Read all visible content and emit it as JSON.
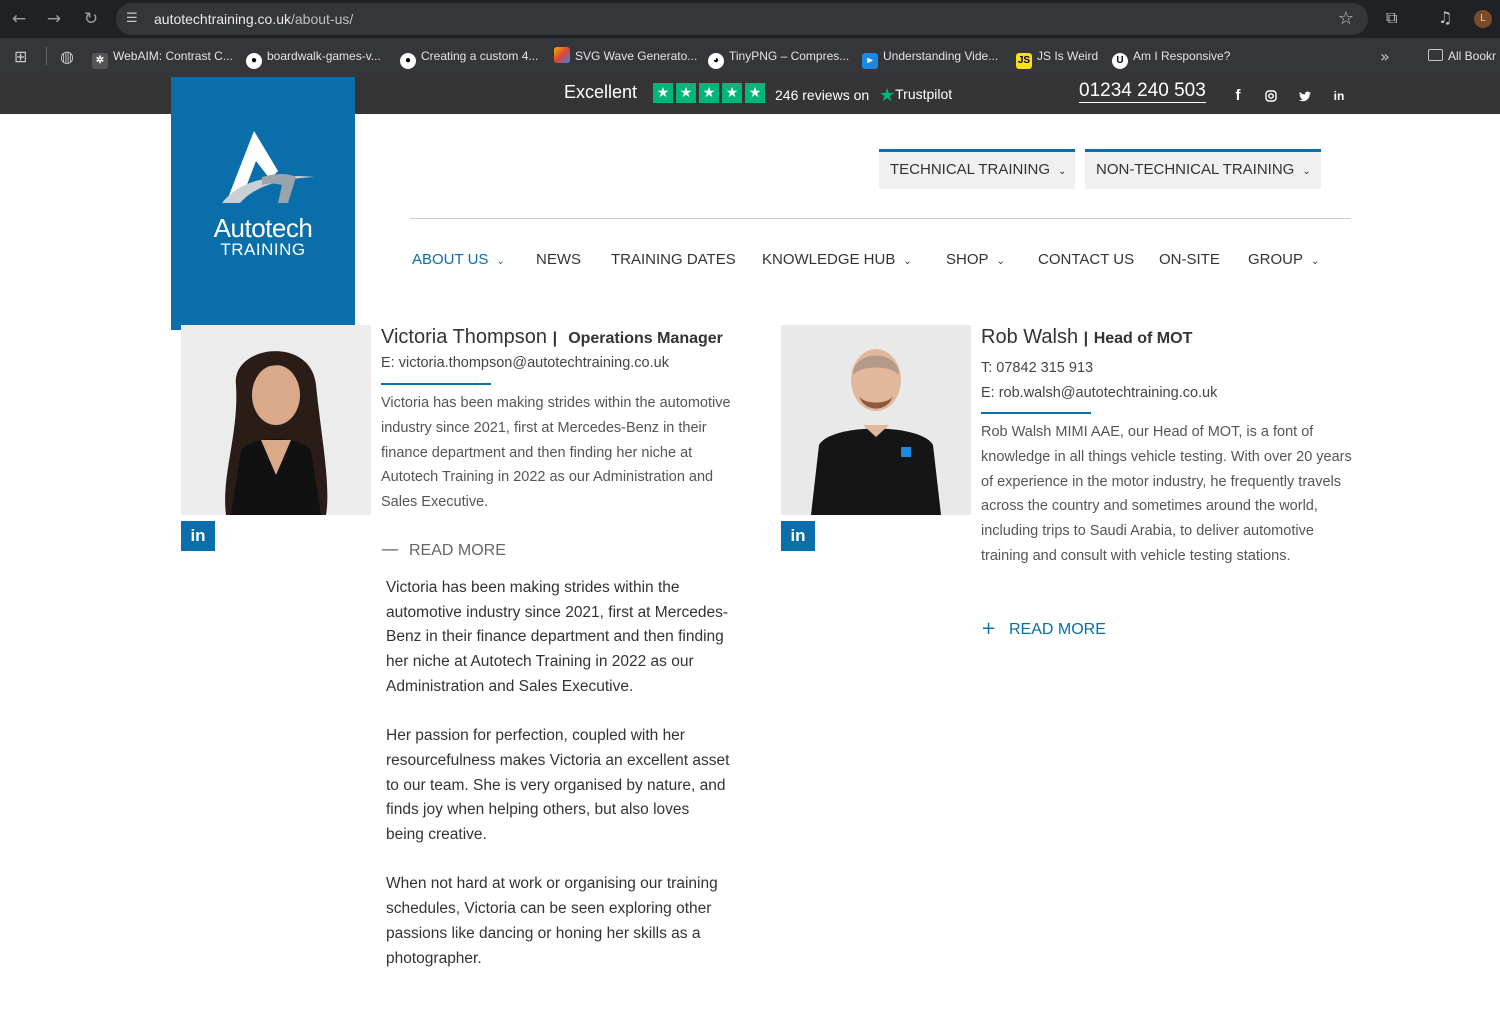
{
  "browser": {
    "url_host": "autotechtraining.co.uk",
    "url_path": "/about-us/",
    "profile_initial": "L",
    "bookmarks": [
      {
        "label": "WebAIM: Contrast C...",
        "icon": "gear-favicon"
      },
      {
        "label": "boardwalk-games-v...",
        "icon": "github-favicon"
      },
      {
        "label": "Creating a custom 4...",
        "icon": "github-favicon"
      },
      {
        "label": "SVG Wave Generato...",
        "icon": "svgwave-favicon"
      },
      {
        "label": "TinyPNG – Compres...",
        "icon": "panda-favicon"
      },
      {
        "label": "Understanding Vide...",
        "icon": "flow-favicon"
      },
      {
        "label": "JS Is Weird",
        "icon": "js-favicon"
      },
      {
        "label": "Am I Responsive?",
        "icon": "ui-favicon"
      }
    ],
    "all_bookmarks_label": "All Bookr"
  },
  "topbar": {
    "trustpilot_rating": "Excellent",
    "reviews_text": "246 reviews on",
    "trustpilot_label": "Trustpilot",
    "phone": "01234 240 503",
    "socials": [
      "facebook-icon",
      "instagram-icon",
      "twitter-icon",
      "linkedin-icon"
    ]
  },
  "logo": {
    "line1": "Autotech",
    "line2": "TRAINING"
  },
  "training_buttons": {
    "technical": "TECHNICAL TRAINING",
    "non_technical": "NON-TECHNICAL TRAINING"
  },
  "nav": {
    "about": "ABOUT US",
    "news": "NEWS",
    "training_dates": "TRAINING DATES",
    "knowledge_hub": "KNOWLEDGE HUB",
    "shop": "SHOP",
    "contact": "CONTACT US",
    "onsite": "ON-SITE",
    "group": "GROUP"
  },
  "colors": {
    "brand": "#0a6eab",
    "trustpilot_green": "#00b67a",
    "topbar": "#353535"
  },
  "people": {
    "victoria": {
      "name": "Victoria Thompson",
      "separator": "|",
      "role": "Operations Manager",
      "email": "E: victoria.thompson@autotechtraining.co.uk",
      "summary": "Victoria has been making strides within the automotive industry since 2021, first at Mercedes-Benz in their finance department and then finding her niche at Autotech Training in 2022 as our Administration and Sales Executive.",
      "read_more": "READ MORE",
      "read_more_symbol": "—",
      "expanded": [
        "Victoria has been making strides within the automotive industry since 2021, first at Mercedes-Benz in their finance department and then finding her niche at Autotech Training in 2022 as our Administration and Sales Executive.",
        "Her passion for perfection, coupled with her resourcefulness makes Victoria an excellent asset to our team. She is very organised by nature, and finds joy when helping others, but also loves being creative.",
        "When not hard at work or organising our training schedules, Victoria can be seen exploring other passions like dancing or honing her skills as a photographer."
      ]
    },
    "rob": {
      "name": "Rob Walsh",
      "separator": "|",
      "role": "Head of MOT",
      "phone": "T: 07842 315 913",
      "email": "E: rob.walsh@autotechtraining.co.uk",
      "summary": "Rob Walsh MIMI AAE, our Head of MOT, is a font of knowledge in all things vehicle testing. With over 20 years of experience in the motor industry, he frequently travels across the country and sometimes around the world, including trips to Saudi Arabia, to deliver automotive training and consult with vehicle testing stations.",
      "read_more": "READ MORE",
      "read_more_symbol": "+"
    }
  },
  "linkedin_label": "in"
}
